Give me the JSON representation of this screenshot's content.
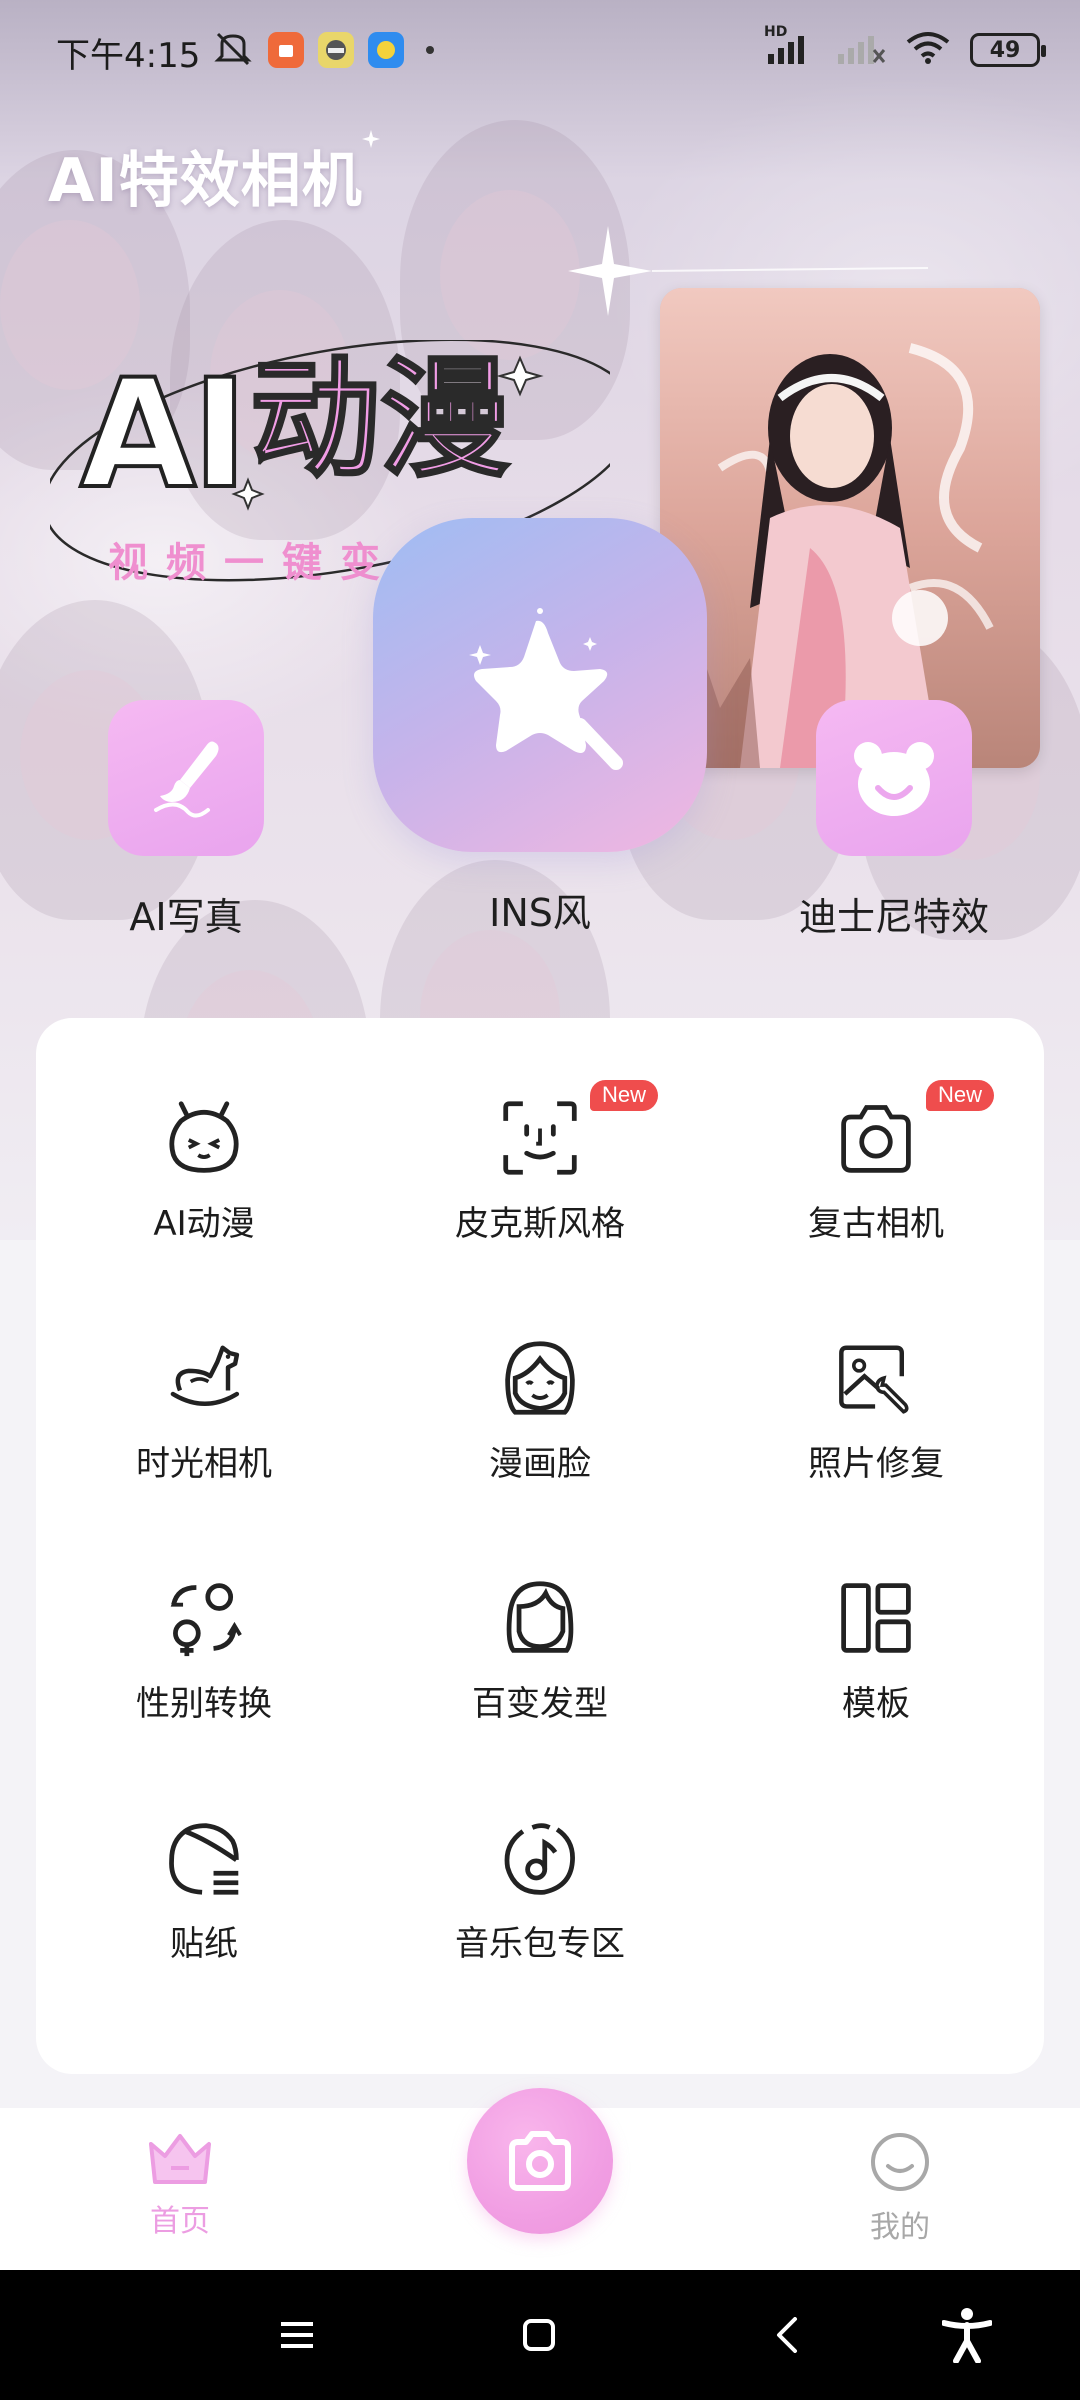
{
  "status_bar": {
    "time": "下午4:15",
    "battery": "49",
    "network_label": "HD"
  },
  "app": {
    "title": "AI特效相机"
  },
  "banner": {
    "headline_ai": "AI",
    "headline_anime": "动漫",
    "subtitle": "视频一键变"
  },
  "quick_actions": [
    {
      "label": "AI写真",
      "icon": "brush-icon"
    },
    {
      "label": "INS风",
      "icon": "magic-star-icon"
    },
    {
      "label": "迪士尼特效",
      "icon": "bear-icon"
    }
  ],
  "grid": [
    {
      "label": "AI动漫",
      "icon": "anime-face-icon",
      "badge": ""
    },
    {
      "label": "皮克斯风格",
      "icon": "face-scan-icon",
      "badge": "New"
    },
    {
      "label": "复古相机",
      "icon": "camera-icon",
      "badge": "New"
    },
    {
      "label": "时光相机",
      "icon": "rocking-horse-icon",
      "badge": ""
    },
    {
      "label": "漫画脸",
      "icon": "cartoon-face-icon",
      "badge": ""
    },
    {
      "label": "照片修复",
      "icon": "photo-repair-icon",
      "badge": ""
    },
    {
      "label": "性别转换",
      "icon": "gender-swap-icon",
      "badge": ""
    },
    {
      "label": "百变发型",
      "icon": "hairstyle-icon",
      "badge": ""
    },
    {
      "label": "模板",
      "icon": "template-icon",
      "badge": ""
    },
    {
      "label": "贴纸",
      "icon": "sticker-icon",
      "badge": ""
    },
    {
      "label": "音乐包专区",
      "icon": "music-icon",
      "badge": ""
    }
  ],
  "bottom_nav": {
    "home": "首页",
    "mine": "我的"
  },
  "colors": {
    "accent_pink": "#f19ee3",
    "badge_red": "#ef4d4d",
    "nav_inactive": "#a8a8a8"
  }
}
